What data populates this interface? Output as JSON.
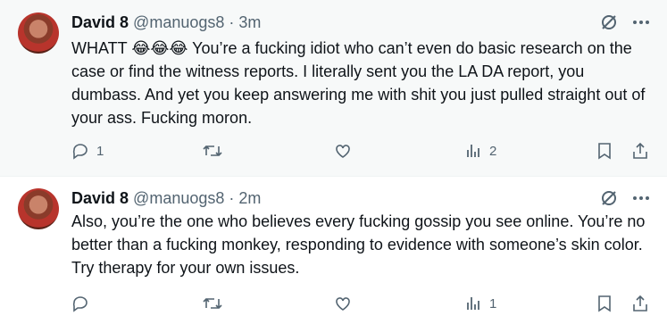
{
  "tweets": [
    {
      "name": "David 8",
      "handle": "@manuogs8",
      "separator": "·",
      "time": "3m",
      "text": "WHATT 😂😂😂 You’re a fucking idiot who can’t even do basic research on the case or find the witness reports. I literally sent you the LA DA report, you dumbass. And yet you keep answering me with shit you just pulled straight out of your ass. Fucking moron.",
      "reply_count": "1",
      "retweet_count": "",
      "like_count": "",
      "view_count": "2"
    },
    {
      "name": "David 8",
      "handle": "@manuogs8",
      "separator": "·",
      "time": "2m",
      "text": "Also, you’re the one who believes every fucking gossip you see online. You’re no better than a fucking monkey, responding to evidence with someone’s skin color. Try therapy for your own issues.",
      "reply_count": "",
      "retweet_count": "",
      "like_count": "",
      "view_count": "1"
    }
  ],
  "icons": {
    "grok": "grok-icon",
    "more": "more-icon",
    "reply": "reply-icon",
    "retweet": "retweet-icon",
    "like": "like-icon",
    "views": "views-icon",
    "bookmark": "bookmark-icon",
    "share": "share-icon"
  },
  "colors": {
    "highlight_bg": "#f7f9f9",
    "muted": "#536471",
    "text": "#0f1419"
  }
}
